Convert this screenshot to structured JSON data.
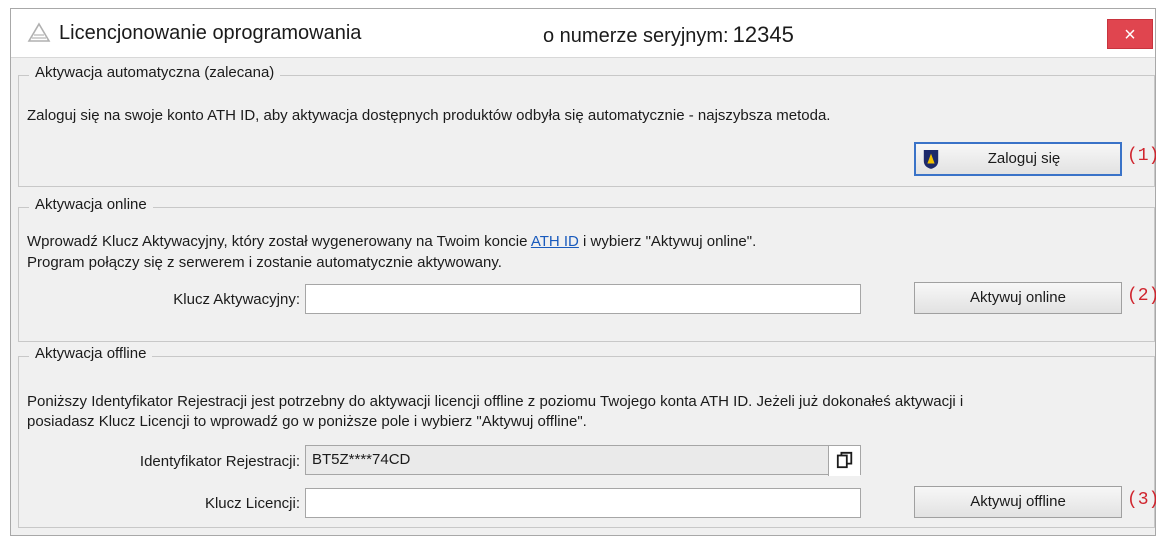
{
  "window": {
    "title": "Licencjonowanie oprogramowania",
    "serial_caption": "o numerze seryjnym:",
    "serial_number": "12345",
    "close_label": "×"
  },
  "auto": {
    "legend": "Aktywacja automatyczna (zalecana)",
    "description": "Zaloguj się na swoje konto ATH ID, aby aktywacja dostępnych produktów odbyła się automatycznie - najszybsza metoda.",
    "login_button": "Zaloguj się",
    "marker": "(1)"
  },
  "online": {
    "legend": "Aktywacja online",
    "description_prefix": "Wprowadź Klucz Aktywacyjny, który został wygenerowany na Twoim koncie ",
    "link": "ATH ID",
    "description_suffix": " i wybierz \"Aktywuj online\".",
    "description_line2": "Program połączy się z serwerem i zostanie automatycznie aktywowany.",
    "key_label": "Klucz Aktywacyjny:",
    "key_value": "",
    "button": "Aktywuj online",
    "marker": "(2)"
  },
  "offline": {
    "legend": "Aktywacja offline",
    "description_line1": "Poniższy Identyfikator Rejestracji jest potrzebny do aktywacji licencji offline z poziomu Twojego konta ATH ID. Jeżeli już dokonałeś aktywacji i",
    "description_line2": "posiadasz Klucz Licencji to wprowadź go w poniższe pole i wybierz \"Aktywuj offline\".",
    "reg_label": "Identyfikator Rejestracji:",
    "reg_value": "BT5Z****74CD",
    "license_label": "Klucz Licencji:",
    "license_value": "",
    "button": "Aktywuj offline",
    "marker": "(3)"
  },
  "icons": {
    "app": "license-app-icon",
    "login": "ath-id-logo-icon",
    "copy": "copy-icon"
  },
  "colors": {
    "close_bg": "#e0454f",
    "link": "#1a5bbd",
    "marker": "#d0252e",
    "focus_border": "#3a73c8"
  }
}
